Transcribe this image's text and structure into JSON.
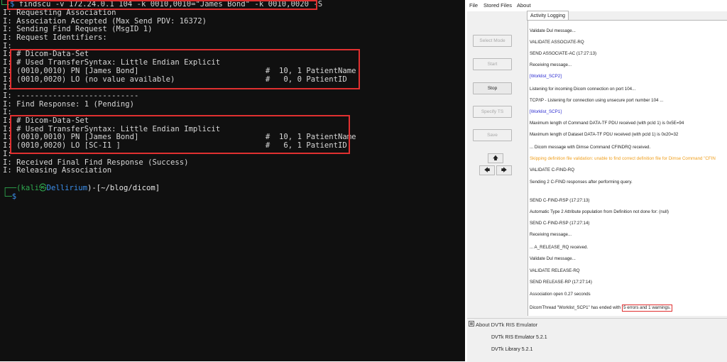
{
  "terminal": {
    "command_prompt": "$",
    "command": "findscu -v 172.24.0.1 104 -k 0010,0010=\"James Bond\" -k 0010,0020 -S",
    "lines": [
      "I: Requesting Association",
      "I: Association Accepted (Max Send PDV: 16372)",
      "I: Sending Find Request (MsgID 1)",
      "I: Request Identifiers:",
      "I:",
      "I: # Dicom-Data-Set",
      "I: # Used TransferSyntax: Little Endian Explicit",
      "I: (0010,0010) PN [James Bond]                            #  10, 1 PatientName",
      "I: (0010,0020) LO (no value available)                    #   0, 0 PatientID",
      "I:",
      "I: ---------------------------",
      "I: Find Response: 1 (Pending)",
      "I:",
      "I: # Dicom-Data-Set",
      "I: # Used TransferSyntax: Little Endian Implicit",
      "I: (0010,0010) PN [James Bond]                            #  10, 1 PatientName",
      "I: (0010,0020) LO [SC-I1 ]                                #   6, 1 PatientID",
      "I:",
      "I: Received Final Find Response (Success)",
      "I: Releasing Association"
    ],
    "prompt_user": "(kali",
    "prompt_at": "㉿",
    "prompt_host": "Dellirium",
    "prompt_path": ")-[~/blog/dicom]",
    "next_prompt": "$"
  },
  "app": {
    "menu": [
      "File",
      "Stored Files",
      "About"
    ],
    "tab": "Activity Logging",
    "buttons": {
      "select_mode": "Select Mode",
      "start": "Start",
      "stop": "Stop",
      "specify_ts": "Specify TS",
      "save": "Save"
    },
    "arrows": {
      "up": "🡅",
      "left": "🡄",
      "right": "🡆"
    },
    "log": [
      {
        "text": "Validate Dul message...",
        "color": "#222222"
      },
      {
        "text": "VALIDATE ASSOCIATE-RQ",
        "color": "#222222"
      },
      {
        "text": "SEND ASSOCIATE-AC (17:27:13)",
        "color": "#222222"
      },
      {
        "text": "Receiving message...",
        "color": "#222222"
      },
      {
        "text": "[Worklist_SCP2]",
        "color": "#2a2ad0"
      },
      {
        "text": "Listening for incoming Dicom connection on port 104...",
        "color": "#222222"
      },
      {
        "text": "TCP/IP - Listening for connection using unsecure port number 104 ...",
        "color": "#222222"
      },
      {
        "text": "[Worklist_SCP1]",
        "color": "#2a2ad0"
      },
      {
        "text": "Maximum length of Command DATA-TF PDU received (with pcId 1) is 0x5E=94",
        "color": "#222222"
      },
      {
        "text": "Maximum length of Dataset DATA-TF PDU received (with pcId 1) is 0x20=32",
        "color": "#222222"
      },
      {
        "text": "... Dicom message with Dimse Command CFINDRQ received.",
        "color": "#222222"
      },
      {
        "text": "Skipping definition file validation: unable to find correct definition file for Dimse Command \"CFIN",
        "color": "#f0a020"
      },
      {
        "text": "VALIDATE C-FIND-RQ",
        "color": "#222222"
      },
      {
        "text": "Sending 2 C-FIND responses after performing query.",
        "color": "#222222"
      },
      {
        "text": "SEND C-FIND-RSP (17:27:13)",
        "color": "#222222"
      },
      {
        "text": "Automatic Type 2 Attribute population from Definition not done for: (null)",
        "color": "#222222"
      },
      {
        "text": "SEND C-FIND-RSP (17:27:14)",
        "color": "#222222"
      },
      {
        "text": "Receiving message...",
        "color": "#222222"
      },
      {
        "text": "... A_RELEASE_RQ received.",
        "color": "#222222"
      },
      {
        "text": "Validate Dul message...",
        "color": "#222222"
      },
      {
        "text": "VALIDATE RELEASE-RQ",
        "color": "#222222"
      },
      {
        "text": "SEND RELEASE-RP (17:27:14)",
        "color": "#222222"
      },
      {
        "text": "Association open 0.27 seconds",
        "color": "#222222"
      },
      {
        "text": "DicomThread \"Worklist_SCP1\" has ended with",
        "color": "#222222"
      }
    ],
    "final_highlight": "5 errors and 1 warnings.",
    "about": {
      "title": "About DVTk RIS Emulator",
      "emulator": "DVTk RIS Emulator 5.2.1",
      "library": "DVTk Library 5.2.1"
    }
  }
}
